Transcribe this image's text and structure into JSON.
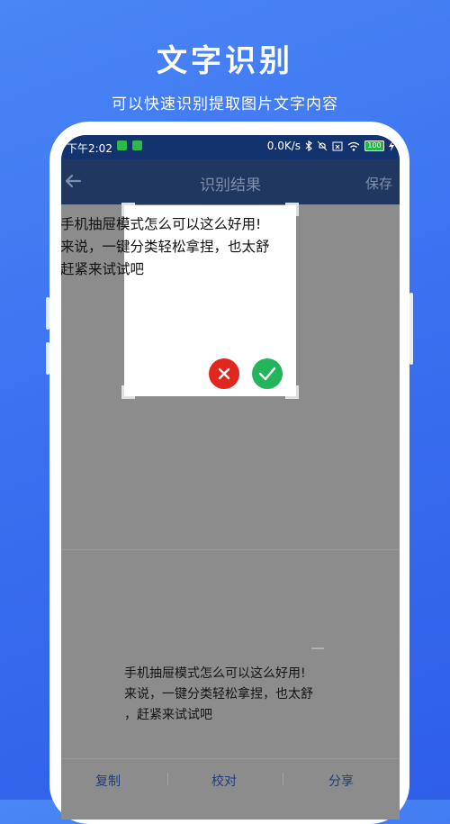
{
  "promo": {
    "title": "文字识别",
    "subtitle": "可以快速识别提取图片文字内容"
  },
  "status_bar": {
    "time": "下午2:02",
    "network_speed": "0.0K/s",
    "battery": "100",
    "icons": [
      "bluetooth-icon",
      "mute-icon",
      "sim-icon",
      "wifi-icon",
      "battery-icon",
      "charging-icon"
    ]
  },
  "header": {
    "title": "识别结果",
    "save_label": "保存",
    "back_icon": "arrow-left-icon"
  },
  "overlay_text": {
    "lines": [
      "手机抽屉模式怎么可以这么好用!",
      "来说，一键分类轻松拿捏，也太舒",
      "赶紧来试试吧"
    ]
  },
  "source_text": {
    "lines": [
      "手机抽屉模式怎么可以这么好用! ",
      " 来说，一键分类轻松拿捏，也太舒",
      "，赶紧来试试吧"
    ]
  },
  "actions": {
    "cancel_icon": "close-icon",
    "confirm_icon": "check-icon"
  },
  "bottom_bar": {
    "copy_label": "复制",
    "proofread_label": "校对",
    "share_label": "分享"
  },
  "colors": {
    "background": "#3a6ff0",
    "status_bar": "#13336e",
    "header": "#203760",
    "cancel": "#e0261d",
    "confirm": "#22b55a",
    "bottom_text": "#1f3b78"
  }
}
